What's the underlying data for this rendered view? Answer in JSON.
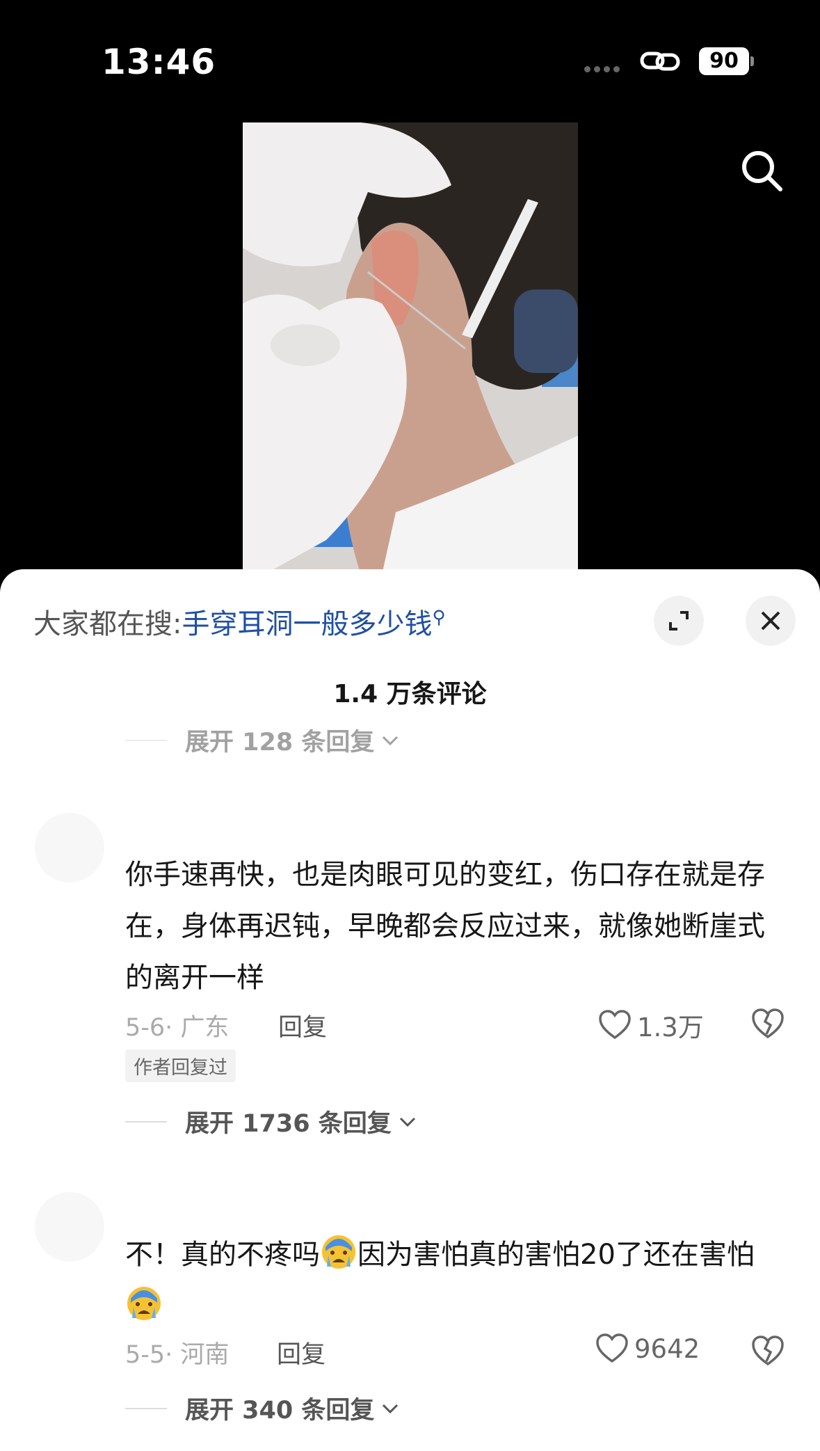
{
  "status_bar": {
    "time": "13:46",
    "battery": "90"
  },
  "sheet": {
    "search_prefix": "大家都在搜:",
    "search_query": "手穿耳洞一般多少钱",
    "comment_count": "1.4 万条评论"
  },
  "comments": [
    {
      "expand_prev": "展开 128 条回复",
      "text": "你手速再快，也是肉眼可见的变红，伤口存在就是存在，身体再迟钝，早晚都会反应过来，就像她断崖式的离开一样",
      "date_location": "5-6· 广东",
      "reply_label": "回复",
      "likes": "1.3万",
      "author_tag": "作者回复过",
      "expand_replies": "展开 1736 条回复"
    },
    {
      "text_part1": "不！真的不疼吗",
      "text_part2": "因为害怕真的害怕20了还在害怕",
      "date_location": "5-5· 河南",
      "reply_label": "回复",
      "likes": "9642",
      "expand_replies": "展开 340 条回复"
    }
  ],
  "icons": {
    "search": "search-icon",
    "expand": "expand-icon",
    "close": "close-icon",
    "like": "heart-icon",
    "dislike": "broken-heart-icon",
    "emoji": "crying-face-emoji"
  }
}
